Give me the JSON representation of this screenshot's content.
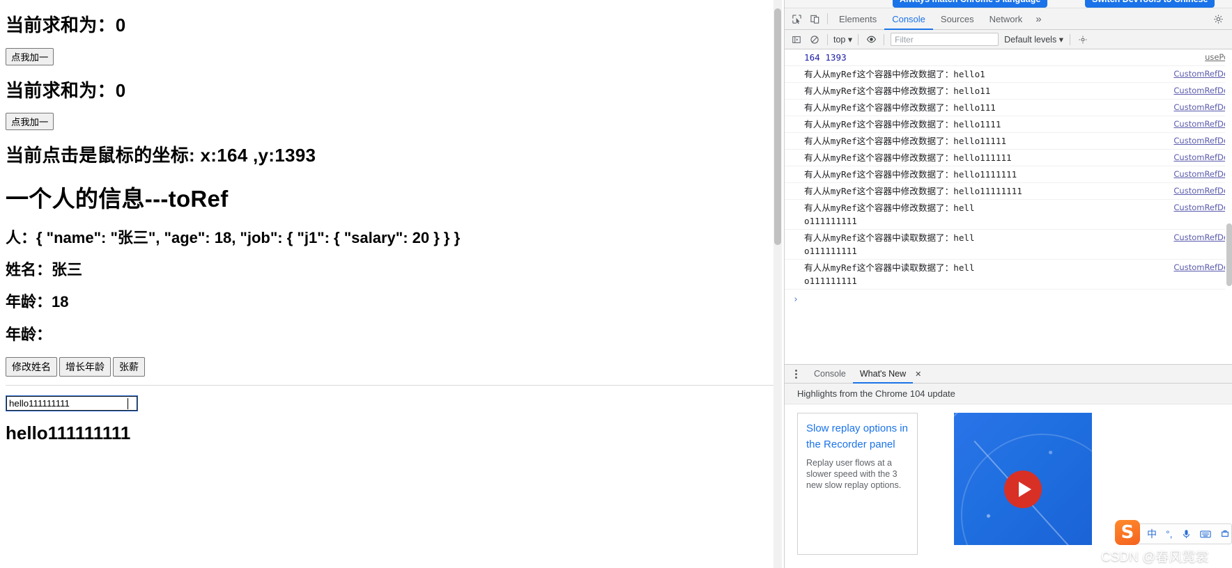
{
  "page": {
    "sum_label_1": "当前求和为：0",
    "button_1": "点我加一",
    "sum_label_2": "当前求和为：0",
    "button_2": "点我加一",
    "mouse_coord_label": "当前点击是鼠标的坐标: x:164 ,y:1393",
    "person_heading": "一个人的信息---toRef",
    "person_json": "人：{ \"name\": \"张三\", \"age\": 18, \"job\": { \"j1\": { \"salary\": 20 } } }",
    "name_label": "姓名：张三",
    "age_label": "年龄：18",
    "age_label_empty": "年龄：",
    "actions": [
      {
        "label": "修改姓名"
      },
      {
        "label": "增长年龄"
      },
      {
        "label": "张薪"
      }
    ],
    "ref_input_value": "hello111111111",
    "ref_output_text": "hello111111111"
  },
  "devtools": {
    "banner": {
      "match_language_button": "Always match Chrome's language",
      "switch_language_button": "Switch DevTools to Chinese"
    },
    "tabs": [
      {
        "label": "Elements",
        "active": false
      },
      {
        "label": "Console",
        "active": true
      },
      {
        "label": "Sources",
        "active": false
      },
      {
        "label": "Network",
        "active": false
      }
    ],
    "more_tabs_glyph": "»",
    "toolbar": {
      "context_selector": "top",
      "context_caret": "▾",
      "filter_placeholder": "Filter",
      "level_selector": "Default levels",
      "level_caret": "▾"
    },
    "console": {
      "prompt_glyph": "›",
      "logs": [
        {
          "type": "numeric",
          "text": "164 1393",
          "source": "usePo"
        },
        {
          "type": "message",
          "prefix": "有人从",
          "mono": "myRef",
          "middle": "这个容器中修改数据了：",
          "value": "hello1",
          "source": "CustomRefDe"
        },
        {
          "type": "message",
          "prefix": "有人从",
          "mono": "myRef",
          "middle": "这个容器中修改数据了：",
          "value": "hello11",
          "source": "CustomRefDe"
        },
        {
          "type": "message",
          "prefix": "有人从",
          "mono": "myRef",
          "middle": "这个容器中修改数据了：",
          "value": "hello111",
          "source": "CustomRefDe"
        },
        {
          "type": "message",
          "prefix": "有人从",
          "mono": "myRef",
          "middle": "这个容器中修改数据了：",
          "value": "hello1111",
          "source": "CustomRefDe"
        },
        {
          "type": "message",
          "prefix": "有人从",
          "mono": "myRef",
          "middle": "这个容器中修改数据了：",
          "value": "hello11111",
          "source": "CustomRefDe"
        },
        {
          "type": "message",
          "prefix": "有人从",
          "mono": "myRef",
          "middle": "这个容器中修改数据了：",
          "value": "hello111111",
          "source": "CustomRefDe"
        },
        {
          "type": "message",
          "prefix": "有人从",
          "mono": "myRef",
          "middle": "这个容器中修改数据了：",
          "value": "hello1111111",
          "source": "CustomRefDe"
        },
        {
          "type": "message",
          "prefix": "有人从",
          "mono": "myRef",
          "middle": "这个容器中修改数据了：",
          "value": "hello11111111",
          "source": "CustomRefDe"
        },
        {
          "type": "message-wrapped",
          "prefix": "有人从",
          "mono": "myRef",
          "middle": "这个容器中修改数据了：",
          "value": "hello111111111",
          "source": "CustomRefDe"
        },
        {
          "type": "message-wrapped",
          "prefix": "有人从",
          "mono": "myRef",
          "middle": "这个容器中读取数据了：",
          "value": "hello111111111",
          "source": "CustomRefDe"
        },
        {
          "type": "message-wrapped",
          "prefix": "有人从",
          "mono": "myRef",
          "middle": "这个容器中读取数据了：",
          "value": "hello111111111",
          "source": "CustomRefDe"
        }
      ]
    },
    "drawer": {
      "tabs": [
        {
          "label": "Console",
          "active": false
        },
        {
          "label": "What's New",
          "active": true
        }
      ],
      "close_glyph": "✕",
      "subtitle": "Highlights from the Chrome 104 update",
      "cards": [
        {
          "title": "Slow replay options in the Recorder panel",
          "description": "Replay user flows at a slower speed with the 3 new slow replay options."
        }
      ]
    }
  },
  "ime": {
    "logo_letter": "S",
    "items": [
      {
        "name": "chinese-mode",
        "glyph": "中"
      },
      {
        "name": "punctuation",
        "glyph": "°,"
      },
      {
        "name": "microphone",
        "glyph": "🎤"
      },
      {
        "name": "keyboard",
        "glyph": "⌨"
      },
      {
        "name": "toolbox",
        "glyph": "▼"
      }
    ]
  },
  "watermark": {
    "text": "CSDN @春风霓裳"
  },
  "colors": {
    "accent_blue": "#1a73e8",
    "banner_blue": "#1a73e8",
    "log_numeric": "#1a1aa6",
    "sogou_orange": "#f4621f",
    "play_red": "#d93025"
  }
}
